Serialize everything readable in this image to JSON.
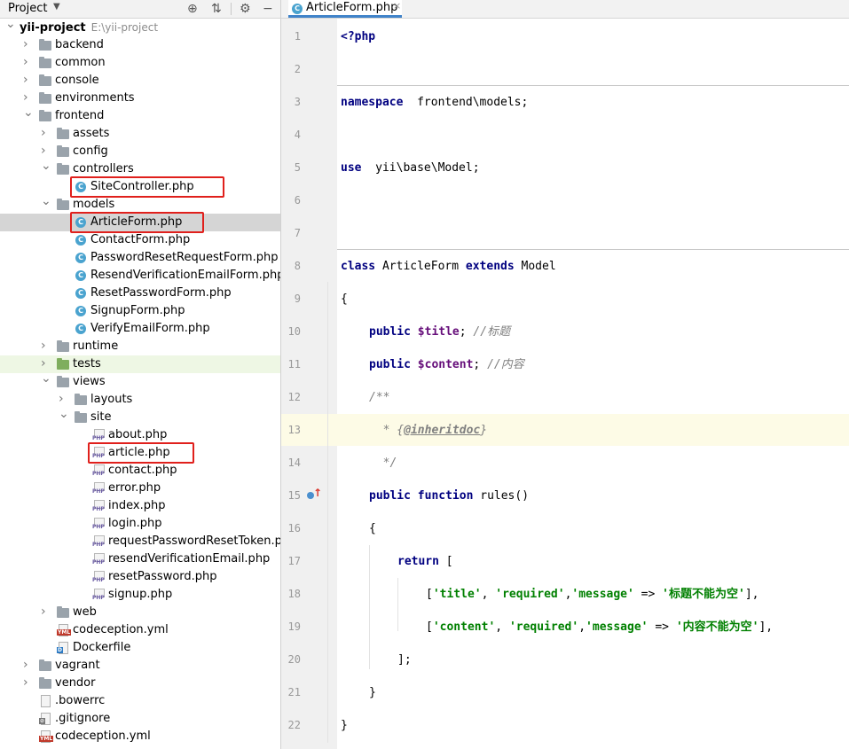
{
  "project_panel": {
    "title": "Project",
    "tree": [
      {
        "name": "yii-project",
        "path": "E:\\yii-project",
        "type": "root",
        "depth": 0,
        "expanded": true
      },
      {
        "name": "backend",
        "type": "folder",
        "depth": 1,
        "expanded": false
      },
      {
        "name": "common",
        "type": "folder",
        "depth": 1,
        "expanded": false
      },
      {
        "name": "console",
        "type": "folder",
        "depth": 1,
        "expanded": false
      },
      {
        "name": "environments",
        "type": "folder",
        "depth": 1,
        "expanded": false
      },
      {
        "name": "frontend",
        "type": "folder",
        "depth": 1,
        "expanded": true
      },
      {
        "name": "assets",
        "type": "folder",
        "depth": 2,
        "expanded": false
      },
      {
        "name": "config",
        "type": "folder",
        "depth": 2,
        "expanded": false
      },
      {
        "name": "controllers",
        "type": "folder",
        "depth": 2,
        "expanded": true
      },
      {
        "name": "SiteController.php",
        "type": "class",
        "depth": 3,
        "highlight": true
      },
      {
        "name": "models",
        "type": "folder",
        "depth": 2,
        "expanded": true
      },
      {
        "name": "ArticleForm.php",
        "type": "class",
        "depth": 3,
        "highlight": true,
        "selected": true
      },
      {
        "name": "ContactForm.php",
        "type": "class",
        "depth": 3
      },
      {
        "name": "PasswordResetRequestForm.php",
        "type": "class",
        "depth": 3
      },
      {
        "name": "ResendVerificationEmailForm.php",
        "type": "class",
        "depth": 3
      },
      {
        "name": "ResetPasswordForm.php",
        "type": "class",
        "depth": 3
      },
      {
        "name": "SignupForm.php",
        "type": "class",
        "depth": 3
      },
      {
        "name": "VerifyEmailForm.php",
        "type": "class",
        "depth": 3
      },
      {
        "name": "runtime",
        "type": "folder",
        "depth": 2,
        "expanded": false
      },
      {
        "name": "tests",
        "type": "test-folder",
        "depth": 2,
        "expanded": false
      },
      {
        "name": "views",
        "type": "folder",
        "depth": 2,
        "expanded": true
      },
      {
        "name": "layouts",
        "type": "folder",
        "depth": 3,
        "expanded": false
      },
      {
        "name": "site",
        "type": "folder",
        "depth": 3,
        "expanded": true
      },
      {
        "name": "about.php",
        "type": "php",
        "depth": 4
      },
      {
        "name": "article.php",
        "type": "php",
        "depth": 4,
        "highlight": true
      },
      {
        "name": "contact.php",
        "type": "php",
        "depth": 4
      },
      {
        "name": "error.php",
        "type": "php",
        "depth": 4
      },
      {
        "name": "index.php",
        "type": "php",
        "depth": 4
      },
      {
        "name": "login.php",
        "type": "php",
        "depth": 4
      },
      {
        "name": "requestPasswordResetToken.php",
        "type": "php",
        "depth": 4
      },
      {
        "name": "resendVerificationEmail.php",
        "type": "php",
        "depth": 4
      },
      {
        "name": "resetPassword.php",
        "type": "php",
        "depth": 4
      },
      {
        "name": "signup.php",
        "type": "php",
        "depth": 4
      },
      {
        "name": "web",
        "type": "folder",
        "depth": 2,
        "expanded": false
      },
      {
        "name": "codeception.yml",
        "type": "yml",
        "depth": 2
      },
      {
        "name": "Dockerfile",
        "type": "docker",
        "depth": 2
      },
      {
        "name": "vagrant",
        "type": "folder",
        "depth": 1,
        "expanded": false
      },
      {
        "name": "vendor",
        "type": "folder",
        "depth": 1,
        "expanded": false
      },
      {
        "name": ".bowerrc",
        "type": "text",
        "depth": 1
      },
      {
        "name": ".gitignore",
        "type": "ignore",
        "depth": 1
      },
      {
        "name": "codeception.yml",
        "type": "yml",
        "depth": 1
      }
    ]
  },
  "editor": {
    "tab_label": "ArticleForm.php",
    "tab_close": "×",
    "current_line": 13,
    "lines": [
      {
        "n": "1",
        "indent": 0,
        "tokens": [
          [
            "kw",
            "<?php"
          ]
        ]
      },
      {
        "n": "2",
        "indent": 0,
        "tokens": []
      },
      {
        "n": "3",
        "indent": 0,
        "tokens": [
          [
            "kw",
            "namespace"
          ],
          [
            "",
            "  frontend\\models;"
          ]
        ]
      },
      {
        "n": "4",
        "indent": 0,
        "tokens": []
      },
      {
        "n": "5",
        "indent": 0,
        "tokens": [
          [
            "kw",
            "use"
          ],
          [
            "",
            "  yii\\base\\Model;"
          ]
        ]
      },
      {
        "n": "6",
        "indent": 0,
        "tokens": []
      },
      {
        "n": "7",
        "indent": 0,
        "tokens": []
      },
      {
        "n": "8",
        "indent": 0,
        "tokens": [
          [
            "kw",
            "class"
          ],
          [
            "",
            " ArticleForm "
          ],
          [
            "kw",
            "extends"
          ],
          [
            "",
            " Model"
          ]
        ]
      },
      {
        "n": "9",
        "indent": 0,
        "tokens": [
          [
            "",
            "{"
          ]
        ]
      },
      {
        "n": "10",
        "indent": 1,
        "tokens": [
          [
            "kw",
            "public"
          ],
          [
            "",
            " "
          ],
          [
            "var",
            "$title"
          ],
          [
            "",
            "; "
          ],
          [
            "cmt",
            "//标题"
          ]
        ]
      },
      {
        "n": "11",
        "indent": 1,
        "tokens": [
          [
            "kw",
            "public"
          ],
          [
            "",
            " "
          ],
          [
            "var",
            "$content"
          ],
          [
            "",
            "; "
          ],
          [
            "cmt",
            "//内容"
          ]
        ]
      },
      {
        "n": "12",
        "indent": 1,
        "tokens": [
          [
            "doc",
            "/**"
          ]
        ]
      },
      {
        "n": "13",
        "indent": 1,
        "tokens": [
          [
            "doc",
            "  * {"
          ],
          [
            "doctag",
            "@inheritdoc"
          ],
          [
            "doc",
            "}"
          ]
        ]
      },
      {
        "n": "14",
        "indent": 1,
        "tokens": [
          [
            "doc",
            "  */"
          ]
        ]
      },
      {
        "n": "15",
        "indent": 1,
        "tokens": [
          [
            "kw",
            "public"
          ],
          [
            "",
            " "
          ],
          [
            "kw",
            "function"
          ],
          [
            "",
            " rules()"
          ]
        ]
      },
      {
        "n": "16",
        "indent": 1,
        "tokens": [
          [
            "",
            "{"
          ]
        ]
      },
      {
        "n": "17",
        "indent": 2,
        "tokens": [
          [
            "kw",
            "return"
          ],
          [
            "",
            " ["
          ]
        ]
      },
      {
        "n": "18",
        "indent": 3,
        "tokens": [
          [
            "",
            "["
          ],
          [
            "str",
            "'title'"
          ],
          [
            "",
            ", "
          ],
          [
            "str",
            "'required'"
          ],
          [
            "",
            ","
          ],
          [
            "str",
            "'message'"
          ],
          [
            "",
            " => "
          ],
          [
            "str",
            "'标题不能为空'"
          ],
          [
            "",
            "],"
          ]
        ]
      },
      {
        "n": "19",
        "indent": 3,
        "tokens": [
          [
            "",
            "["
          ],
          [
            "str",
            "'content'"
          ],
          [
            "",
            ", "
          ],
          [
            "str",
            "'required'"
          ],
          [
            "",
            ","
          ],
          [
            "str",
            "'message'"
          ],
          [
            "",
            " => "
          ],
          [
            "str",
            "'内容不能为空'"
          ],
          [
            "",
            "],"
          ]
        ]
      },
      {
        "n": "20",
        "indent": 2,
        "tokens": [
          [
            "",
            "];"
          ]
        ]
      },
      {
        "n": "21",
        "indent": 1,
        "tokens": [
          [
            "",
            "}"
          ]
        ]
      },
      {
        "n": "22",
        "indent": 0,
        "tokens": [
          [
            "",
            "}"
          ]
        ]
      }
    ]
  }
}
